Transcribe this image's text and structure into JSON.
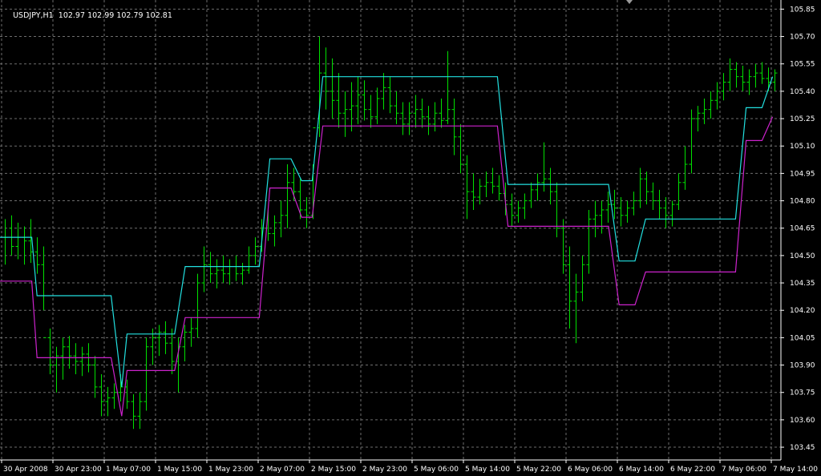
{
  "window": {
    "symbol_label": "USDJPY,H1",
    "ohlc_values": [
      "102.97",
      "102.99",
      "102.79",
      "102.81"
    ]
  },
  "colors": {
    "background": "#000000",
    "grid": "#6e6e6e",
    "bar": "#00e000",
    "upper_line": "#22e0e0",
    "lower_line": "#cc22cc",
    "axis": "#ffffff"
  },
  "chart_data": {
    "type": "line",
    "title": "",
    "xlabel": "",
    "ylabel": "",
    "grid": true,
    "ylim": [
      103.38,
      105.9
    ],
    "y_ticks": [
      "105.85",
      "105.70",
      "105.55",
      "105.40",
      "105.25",
      "105.10",
      "104.95",
      "104.80",
      "104.65",
      "104.50",
      "104.35",
      "104.20",
      "104.05",
      "103.90",
      "103.75",
      "103.60",
      "103.45"
    ],
    "x_ticks": [
      "30 Apr 2008",
      "30 Apr 23:00",
      "1 May 07:00",
      "1 May 15:00",
      "1 May 23:00",
      "2 May 07:00",
      "2 May 15:00",
      "2 May 23:00",
      "5 May 06:00",
      "5 May 14:00",
      "5 May 22:00",
      "6 May 06:00",
      "6 May 14:00",
      "6 May 22:00",
      "7 May 06:00",
      "7 May 14:00"
    ],
    "bars_per_tick": 8,
    "bar_count": 121,
    "price_bars": [
      [
        104.6,
        104.7,
        104.45,
        104.6
      ],
      [
        104.65,
        104.72,
        104.5,
        104.55
      ],
      [
        104.55,
        104.68,
        104.48,
        104.6
      ],
      [
        104.6,
        104.66,
        104.45,
        104.58
      ],
      [
        104.58,
        104.7,
        104.46,
        104.52
      ],
      [
        104.52,
        104.6,
        104.4,
        104.45
      ],
      [
        104.45,
        104.55,
        104.2,
        104.05
      ],
      [
        104.05,
        104.1,
        103.85,
        103.9
      ],
      [
        103.9,
        104.0,
        103.75,
        103.95
      ],
      [
        103.95,
        104.05,
        103.82,
        104.0
      ],
      [
        104.0,
        104.06,
        103.88,
        103.95
      ],
      [
        103.95,
        104.02,
        103.85,
        103.92
      ],
      [
        103.92,
        104.0,
        103.84,
        103.96
      ],
      [
        103.96,
        104.02,
        103.86,
        103.9
      ],
      [
        103.9,
        103.95,
        103.72,
        103.78
      ],
      [
        103.78,
        103.85,
        103.62,
        103.7
      ],
      [
        103.7,
        103.78,
        103.62,
        103.72
      ],
      [
        103.72,
        103.8,
        103.66,
        103.75
      ],
      [
        103.75,
        103.85,
        103.7,
        103.78
      ],
      [
        103.78,
        103.82,
        103.66,
        103.7
      ],
      [
        103.7,
        103.74,
        103.55,
        103.62
      ],
      [
        103.62,
        103.75,
        103.55,
        103.7
      ],
      [
        103.7,
        104.05,
        103.65,
        104.0
      ],
      [
        104.0,
        104.1,
        103.9,
        104.05
      ],
      [
        104.05,
        104.12,
        103.95,
        104.08
      ],
      [
        104.08,
        104.14,
        103.96,
        104.02
      ],
      [
        104.02,
        104.1,
        103.85,
        103.92
      ],
      [
        103.92,
        104.05,
        103.75,
        104.0
      ],
      [
        104.0,
        104.12,
        103.92,
        104.08
      ],
      [
        104.08,
        104.16,
        104.0,
        104.1
      ],
      [
        104.1,
        104.4,
        104.05,
        104.35
      ],
      [
        104.35,
        104.55,
        104.3,
        104.45
      ],
      [
        104.45,
        104.52,
        104.35,
        104.4
      ],
      [
        104.4,
        104.48,
        104.32,
        104.42
      ],
      [
        104.42,
        104.5,
        104.35,
        104.4
      ],
      [
        104.4,
        104.48,
        104.34,
        104.44
      ],
      [
        104.44,
        104.5,
        104.36,
        104.4
      ],
      [
        104.4,
        104.46,
        104.34,
        104.42
      ],
      [
        104.42,
        104.55,
        104.4,
        104.5
      ],
      [
        104.5,
        104.6,
        104.45,
        104.55
      ],
      [
        104.55,
        104.7,
        104.52,
        104.65
      ],
      [
        104.65,
        104.75,
        104.58,
        104.62
      ],
      [
        104.62,
        104.72,
        104.55,
        104.68
      ],
      [
        104.68,
        104.8,
        104.6,
        104.72
      ],
      [
        104.72,
        105.0,
        104.65,
        104.9
      ],
      [
        104.9,
        104.98,
        104.8,
        104.85
      ],
      [
        104.85,
        104.92,
        104.7,
        104.75
      ],
      [
        104.75,
        104.82,
        104.65,
        104.72
      ],
      [
        104.72,
        105.0,
        104.7,
        105.2
      ],
      [
        105.2,
        105.7,
        105.15,
        105.5
      ],
      [
        105.5,
        105.64,
        105.3,
        105.4
      ],
      [
        105.4,
        105.58,
        105.25,
        105.35
      ],
      [
        105.35,
        105.5,
        105.2,
        105.28
      ],
      [
        105.28,
        105.4,
        105.15,
        105.3
      ],
      [
        105.3,
        105.45,
        105.18,
        105.32
      ],
      [
        105.32,
        105.48,
        105.22,
        105.38
      ],
      [
        105.38,
        105.46,
        105.24,
        105.3
      ],
      [
        105.3,
        105.38,
        105.2,
        105.26
      ],
      [
        105.26,
        105.42,
        105.22,
        105.36
      ],
      [
        105.36,
        105.5,
        105.3,
        105.42
      ],
      [
        105.42,
        105.48,
        105.28,
        105.32
      ],
      [
        105.32,
        105.4,
        105.22,
        105.28
      ],
      [
        105.28,
        105.34,
        105.16,
        105.22
      ],
      [
        105.22,
        105.34,
        105.16,
        105.28
      ],
      [
        105.28,
        105.38,
        105.2,
        105.3
      ],
      [
        105.3,
        105.36,
        105.2,
        105.26
      ],
      [
        105.26,
        105.32,
        105.16,
        105.22
      ],
      [
        105.22,
        105.34,
        105.18,
        105.28
      ],
      [
        105.28,
        105.36,
        105.2,
        105.24
      ],
      [
        105.24,
        105.62,
        105.22,
        105.3
      ],
      [
        105.3,
        105.36,
        105.05,
        105.15
      ],
      [
        105.15,
        105.22,
        104.95,
        105.0
      ],
      [
        105.0,
        105.05,
        104.7,
        104.85
      ],
      [
        104.85,
        104.95,
        104.75,
        104.82
      ],
      [
        104.82,
        104.92,
        104.78,
        104.88
      ],
      [
        104.88,
        104.96,
        104.82,
        104.9
      ],
      [
        104.9,
        104.98,
        104.84,
        104.88
      ],
      [
        104.88,
        104.94,
        104.8,
        104.84
      ],
      [
        104.84,
        104.9,
        104.72,
        104.78
      ],
      [
        104.78,
        104.84,
        104.66,
        104.72
      ],
      [
        104.72,
        104.8,
        104.68,
        104.76
      ],
      [
        104.76,
        104.84,
        104.7,
        104.8
      ],
      [
        104.8,
        104.9,
        104.76,
        104.86
      ],
      [
        104.86,
        104.95,
        104.8,
        104.9
      ],
      [
        104.9,
        105.12,
        104.85,
        104.92
      ],
      [
        104.92,
        104.98,
        104.78,
        104.85
      ],
      [
        104.85,
        104.9,
        104.6,
        104.65
      ],
      [
        104.65,
        104.7,
        104.4,
        104.45
      ],
      [
        104.45,
        104.55,
        104.1,
        104.25
      ],
      [
        104.25,
        104.4,
        104.02,
        104.3
      ],
      [
        104.3,
        104.5,
        104.25,
        104.45
      ],
      [
        104.45,
        104.75,
        104.4,
        104.7
      ],
      [
        104.7,
        104.8,
        104.6,
        104.72
      ],
      [
        104.72,
        104.8,
        104.62,
        104.75
      ],
      [
        104.75,
        104.85,
        104.68,
        104.78
      ],
      [
        104.78,
        104.86,
        104.7,
        104.76
      ],
      [
        104.76,
        104.82,
        104.66,
        104.72
      ],
      [
        104.72,
        104.8,
        104.68,
        104.76
      ],
      [
        104.76,
        104.85,
        104.72,
        104.8
      ],
      [
        104.8,
        104.98,
        104.76,
        104.92
      ],
      [
        104.92,
        104.96,
        104.78,
        104.85
      ],
      [
        104.85,
        104.9,
        104.75,
        104.8
      ],
      [
        104.8,
        104.86,
        104.7,
        104.76
      ],
      [
        104.76,
        104.82,
        104.65,
        104.72
      ],
      [
        104.72,
        104.8,
        104.66,
        104.78
      ],
      [
        104.78,
        104.95,
        104.75,
        104.9
      ],
      [
        104.9,
        105.1,
        104.86,
        105.0
      ],
      [
        105.0,
        105.3,
        104.95,
        105.25
      ],
      [
        105.25,
        105.32,
        105.18,
        105.28
      ],
      [
        105.28,
        105.36,
        105.22,
        105.3
      ],
      [
        105.3,
        105.4,
        105.25,
        105.35
      ],
      [
        105.35,
        105.45,
        105.3,
        105.4
      ],
      [
        105.4,
        105.5,
        105.35,
        105.45
      ],
      [
        105.45,
        105.58,
        105.4,
        105.52
      ],
      [
        105.52,
        105.56,
        105.42,
        105.48
      ],
      [
        105.48,
        105.54,
        105.4,
        105.45
      ],
      [
        105.45,
        105.52,
        105.38,
        105.48
      ],
      [
        105.48,
        105.55,
        105.42,
        105.5
      ],
      [
        105.5,
        105.56,
        105.44,
        105.47
      ],
      [
        105.47,
        105.53,
        105.4,
        105.45
      ],
      [
        105.45,
        105.52,
        105.4,
        105.5
      ]
    ],
    "series": [
      {
        "color": "#22e0e0",
        "points": [
          [
            0,
            104.6
          ],
          [
            6,
            104.6
          ],
          [
            7,
            104.28
          ],
          [
            21,
            104.28
          ],
          [
            23,
            103.78
          ],
          [
            24,
            104.07
          ],
          [
            33,
            104.07
          ],
          [
            35,
            104.44
          ],
          [
            49,
            104.44
          ],
          [
            51,
            105.03
          ],
          [
            55,
            105.03
          ],
          [
            57,
            104.91
          ],
          [
            59,
            104.91
          ],
          [
            61,
            105.48
          ],
          [
            94,
            105.48
          ],
          [
            96,
            104.89
          ],
          [
            115,
            104.89
          ],
          [
            117,
            104.47
          ],
          [
            120,
            104.47
          ],
          [
            122,
            104.7
          ],
          [
            139,
            104.7
          ],
          [
            141,
            105.31
          ],
          [
            144,
            105.31
          ],
          [
            146,
            105.48
          ]
        ]
      },
      {
        "color": "#cc22cc",
        "points": [
          [
            0,
            104.36
          ],
          [
            6,
            104.36
          ],
          [
            7,
            103.94
          ],
          [
            21,
            103.94
          ],
          [
            23,
            103.62
          ],
          [
            24,
            103.87
          ],
          [
            33,
            103.87
          ],
          [
            35,
            104.16
          ],
          [
            49,
            104.16
          ],
          [
            51,
            104.87
          ],
          [
            55,
            104.87
          ],
          [
            57,
            104.71
          ],
          [
            59,
            104.71
          ],
          [
            61,
            105.21
          ],
          [
            94,
            105.21
          ],
          [
            96,
            104.66
          ],
          [
            115,
            104.66
          ],
          [
            117,
            104.23
          ],
          [
            120,
            104.23
          ],
          [
            122,
            104.41
          ],
          [
            139,
            104.41
          ],
          [
            141,
            105.13
          ],
          [
            144,
            105.13
          ],
          [
            146,
            105.26
          ]
        ]
      }
    ]
  }
}
